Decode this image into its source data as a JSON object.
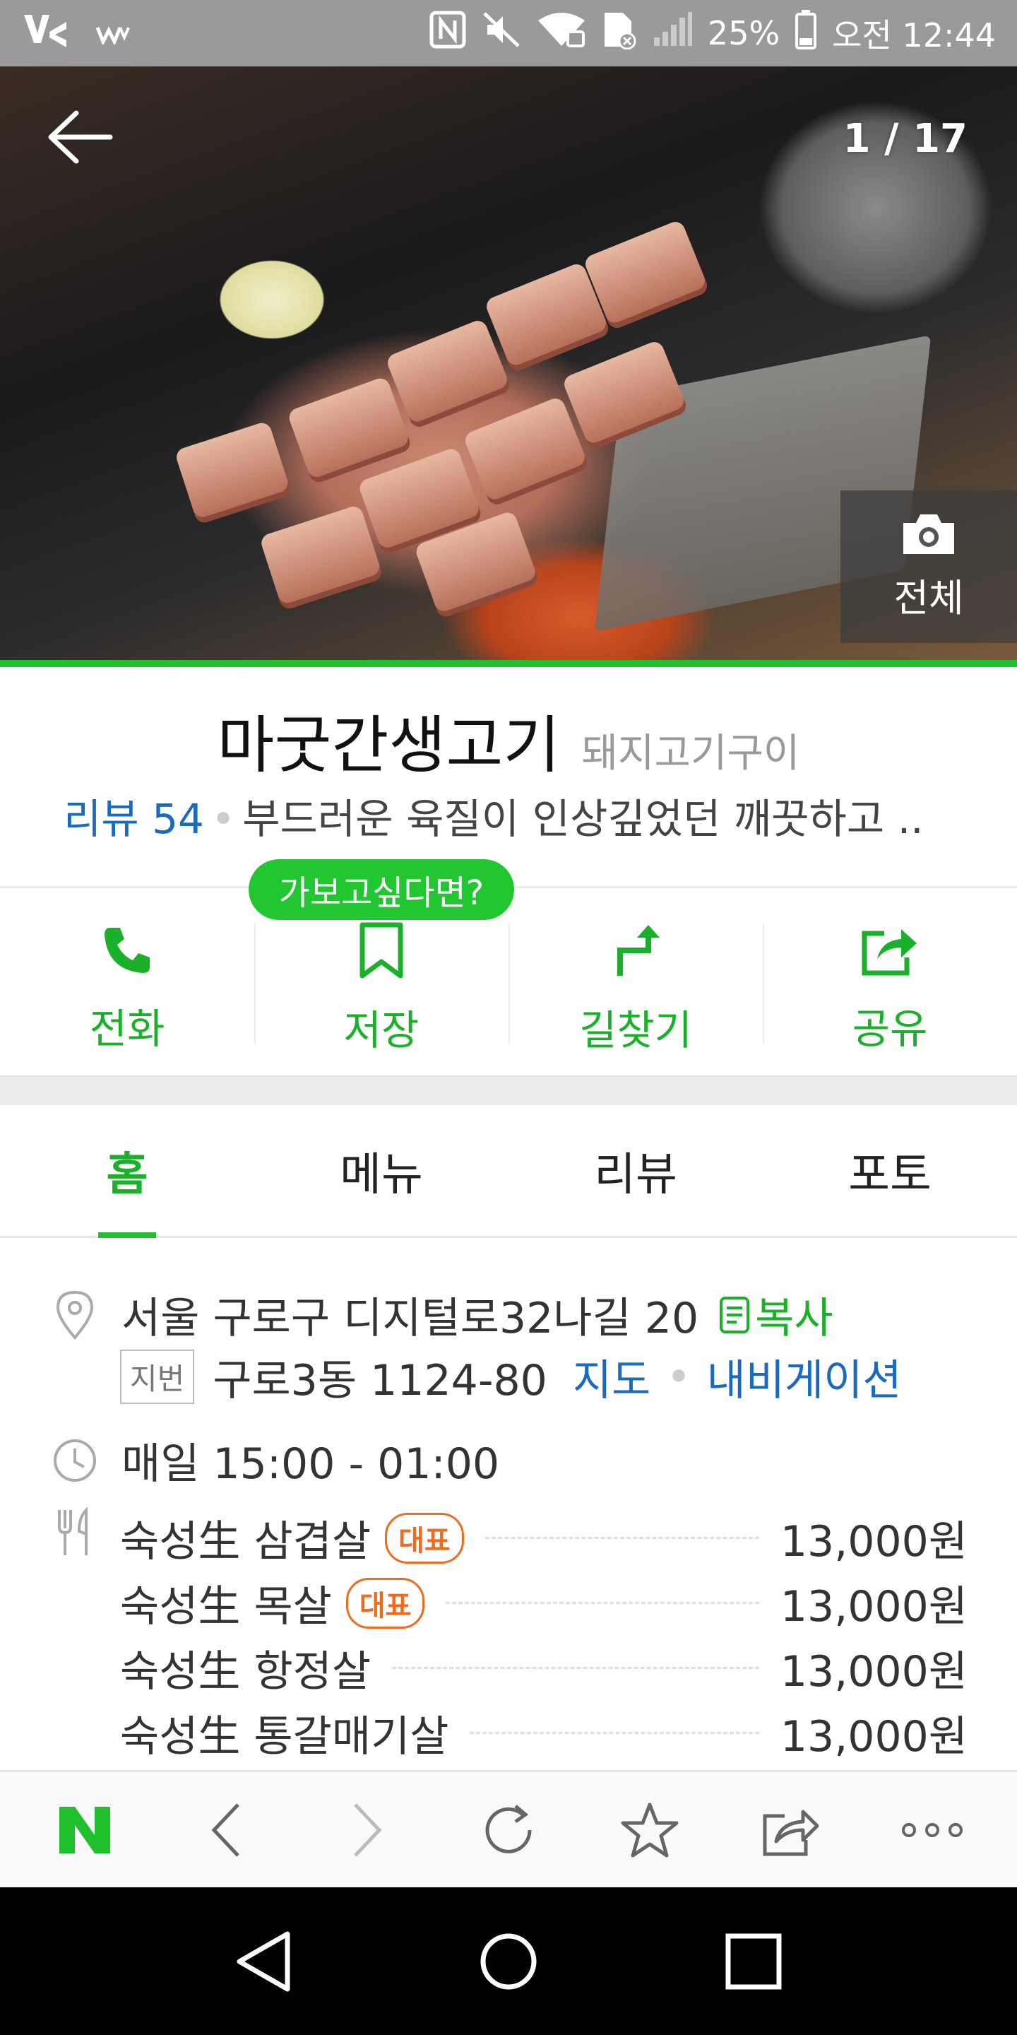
{
  "status_bar": {
    "battery": "25%",
    "time": "오전 12:44"
  },
  "hero": {
    "counter": "1 / 17",
    "all_photos_label": "전체"
  },
  "place": {
    "name": "마굿간생고기",
    "category": "돼지고기구이",
    "review_label": "리뷰 54",
    "review_snippet": "부드러운 육질이 인상깊었던 깨끗하고 .."
  },
  "actions": {
    "bubble": "가보고싶다면?",
    "call": "전화",
    "save": "저장",
    "directions": "길찾기",
    "share": "공유"
  },
  "tabs": [
    "홈",
    "메뉴",
    "리뷰",
    "포토"
  ],
  "info": {
    "address": "서울 구로구 디지털로32나길 20",
    "copy_label": "복사",
    "jibun_label": "지번",
    "jibun_address": "구로3동 1124-80",
    "map_link": "지도",
    "navigation_link": "내비게이션",
    "hours": "매일 15:00 - 01:00"
  },
  "menu": [
    {
      "name": "숙성生 삼겹살",
      "badge": "대표",
      "price": "13,000원"
    },
    {
      "name": "숙성生 목살",
      "badge": "대표",
      "price": "13,000원"
    },
    {
      "name": "숙성生 항정살",
      "badge": "",
      "price": "13,000원"
    },
    {
      "name": "숙성生 통갈매기살",
      "badge": "",
      "price": "13,000원"
    }
  ],
  "colors": {
    "naver_green": "#1fc02b",
    "link_blue": "#1a6bbf",
    "badge_orange": "#f26b1d"
  }
}
